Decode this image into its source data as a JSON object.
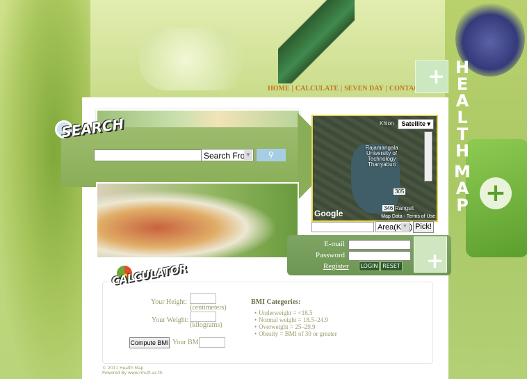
{
  "site": {
    "vertical_title": [
      "H",
      "E",
      "A",
      "L",
      "T",
      "H",
      "",
      "M",
      "A",
      "P"
    ]
  },
  "nav": {
    "items": [
      "HOME",
      "CALCULATE",
      "SEVEN DAY",
      "CONTACT US"
    ],
    "separator": "|"
  },
  "search": {
    "logo": "SEARCH",
    "select_value": "Search From",
    "button_icon": "search-icon"
  },
  "map": {
    "type_selector": "Satellite",
    "labels": [
      "Khlon",
      "Rajamangala University of Technology Thanyaburi",
      "Rangsit",
      "Map Data",
      "Terms of Use"
    ],
    "road_badges": [
      "305",
      "346"
    ],
    "brand": "Google",
    "area_select": "Area(Km.)",
    "pick_label": "Pick!"
  },
  "login": {
    "email_label": "E-mail",
    "password_label": "Password",
    "register_label": "Register",
    "login_label": "LOGIN",
    "reset_label": "RESET"
  },
  "calculator": {
    "logo": "CALCULATOR",
    "height_label": "Your Height:",
    "height_unit": "(centimeters)",
    "weight_label": "Your Weight:",
    "weight_unit": "(kilograms)",
    "compute_label": "Compute BMI",
    "bmi_label": "Your BMI:",
    "categories_title": "BMI Categories:",
    "categories": [
      "Underweight = <18.5",
      "Normal weight = 18.5–24.9",
      "Overweight = 25–29.9",
      "Obesity = BMI of 30 or greater"
    ]
  },
  "footer": {
    "line1": "© 2011 Health Map",
    "line2": "Powered By www.rmutt.ac.th"
  },
  "colors": {
    "nav": "#c1761c",
    "band": "#8aae58",
    "login_band": "#7ea564",
    "accent_plus": "#cfe6c0"
  }
}
